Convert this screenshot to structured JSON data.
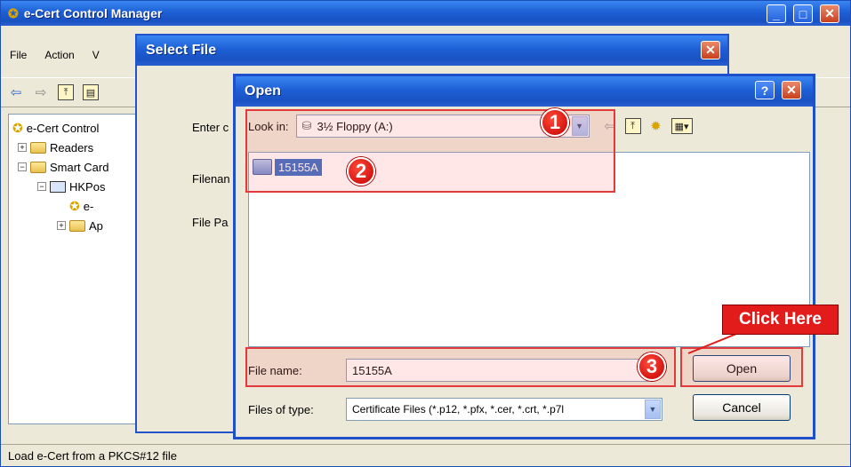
{
  "main_window": {
    "title": "e-Cert Control Manager",
    "menu": [
      "File",
      "Action",
      "V"
    ],
    "tree": [
      {
        "label": "e-Cert Control",
        "icon": "cert-icon",
        "indent": 0
      },
      {
        "label": "Readers",
        "icon": "folder-icon",
        "expander": "+",
        "indent": 1
      },
      {
        "label": "Smart Card",
        "icon": "folder-icon",
        "expander": "-",
        "indent": 1
      },
      {
        "label": "HKPos",
        "icon": "hkpost-icon",
        "expander": "-",
        "indent": 2
      },
      {
        "label": "e-",
        "icon": "cert-icon",
        "indent": 3
      },
      {
        "label": "Ap",
        "icon": "folder-icon",
        "expander": "+",
        "indent": 3
      }
    ],
    "status": "Load e-Cert from a PKCS#12 file"
  },
  "select_file_dialog": {
    "title": "Select File",
    "labels": [
      "Enter c",
      "Filenan",
      "File Pa"
    ]
  },
  "open_dialog": {
    "title": "Open",
    "look_in_label": "Look in:",
    "look_in_value": "3½ Floppy (A:)",
    "files": [
      "15155A"
    ],
    "file_name_label": "File name:",
    "file_name_value": "15155A",
    "files_of_type_label": "Files of type:",
    "files_of_type_value": "Certificate Files (*.p12, *.pfx, *.cer, *.crt, *.p7l",
    "open_button": "Open",
    "cancel_button": "Cancel"
  },
  "annotations": {
    "step1": "1",
    "step2": "2",
    "step3": "3",
    "click_here": "Click Here",
    "highlight_color": "#e23a3a"
  }
}
